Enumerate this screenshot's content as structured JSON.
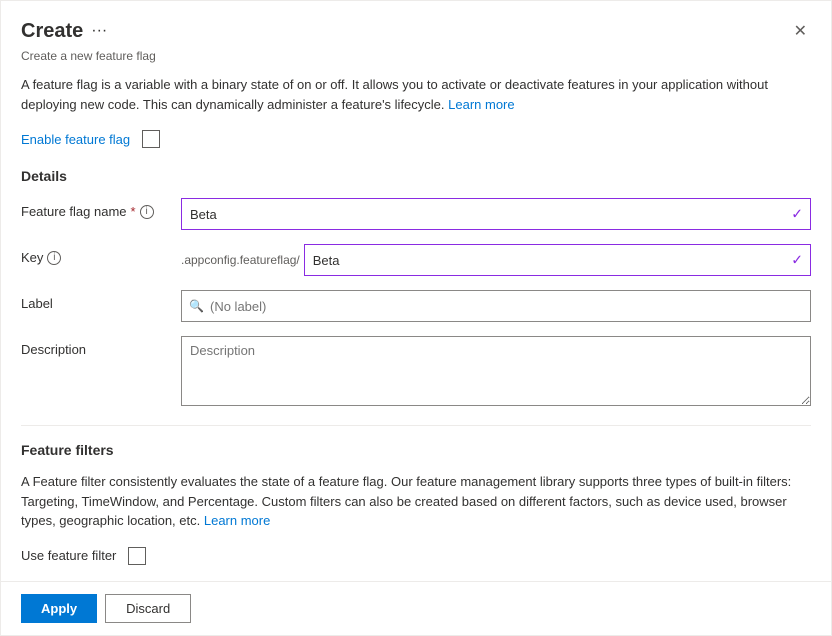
{
  "dialog": {
    "title": "Create",
    "ellipsis": "···",
    "subtitle": "Create a new feature flag",
    "close_label": "✕"
  },
  "intro": {
    "text1": "A feature flag is a variable with a binary state of on or off. It allows you to activate or deactivate features in your application without deploying new code. This can dynamically administer a feature's lifecycle.",
    "learn_more": "Learn more"
  },
  "enable": {
    "label": "Enable feature flag"
  },
  "details": {
    "section_title": "Details",
    "fields": [
      {
        "label": "Feature flag name",
        "required": true,
        "has_info": true,
        "value": "Beta",
        "type": "text_with_check"
      },
      {
        "label": "Key",
        "required": false,
        "has_info": true,
        "prefix": ".appconfig.featureflag/",
        "value": "Beta",
        "type": "key"
      },
      {
        "label": "Label",
        "required": false,
        "has_info": false,
        "placeholder": "(No label)",
        "type": "label_search"
      },
      {
        "label": "Description",
        "required": false,
        "has_info": false,
        "placeholder": "Description",
        "type": "textarea"
      }
    ]
  },
  "feature_filters": {
    "section_title": "Feature filters",
    "description": "A Feature filter consistently evaluates the state of a feature flag. Our feature management library supports three types of built-in filters: Targeting, TimeWindow, and Percentage. Custom filters can also be created based on different factors, such as device used, browser types, geographic location, etc.",
    "learn_more": "Learn more",
    "use_filter_label": "Use feature filter"
  },
  "footer": {
    "apply_label": "Apply",
    "discard_label": "Discard"
  }
}
